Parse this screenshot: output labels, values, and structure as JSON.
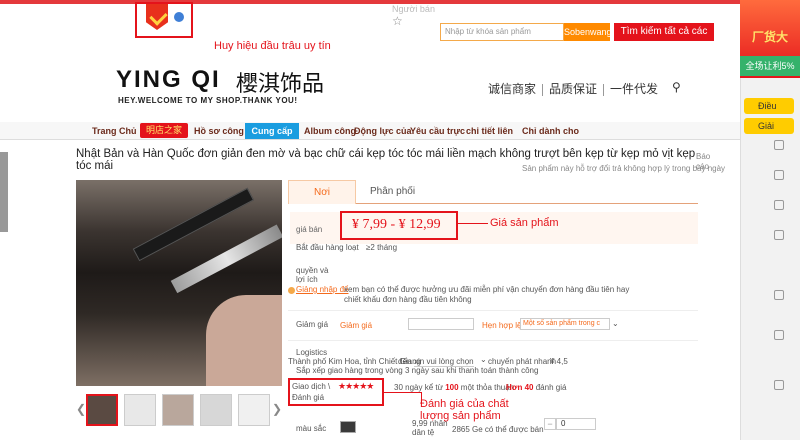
{
  "top": {
    "nav_text": "Người bán",
    "star": "☆"
  },
  "badge": {
    "annotation": "Huy hiệu đầu trâu uy tín"
  },
  "search": {
    "placeholder": "Nhập từ khóa sản phẩm",
    "button": "Sobenwang",
    "search_all": "Tìm kiếm tất cả các đài"
  },
  "promo": {
    "title": "厂货大",
    "sub": "全场让利5%"
  },
  "shop": {
    "name": "YING QI",
    "name_cn": "櫻淇饰品",
    "slogan": "HEY.WELCOME TO MY SHOP.THANK YOU!",
    "guarantees": [
      "诚信商家",
      "品质保证",
      "一件代发"
    ]
  },
  "nav": {
    "items": [
      "Trang Chủ",
      "明店之家",
      "Hồ sơ công ty",
      "Cung cấp sản",
      "Album công",
      "Động lực của",
      "Yêu cầu trực",
      "chi tiết liên",
      "Chỉ dành cho"
    ]
  },
  "side": {
    "items": [
      "Điều",
      "Giải"
    ]
  },
  "product": {
    "title": "Nhật Bản và Hàn Quốc đơn giản đen mờ và bạc chữ cái kẹp tóc tóc mái liền mạch không trượt bên kẹp từ kẹp mỏ vịt kẹp tóc mái",
    "subtitle": "Sản phẩm này hỗ trợ đổi trả không hợp lý trong bảy ngày",
    "report": "Báo cáo"
  },
  "tabs": [
    "Nơi",
    "Phân phối"
  ],
  "price": {
    "label": "giá bán",
    "value": "¥ 7,99  -  ¥ 12,99",
    "annotation": "Giá sản phẩm",
    "batch_label": "Bắt đầu hàng loạt",
    "batch_value": "≥2 tháng"
  },
  "rights": {
    "label": "quyền và lợi ích",
    "link": "Giảng nhập để",
    "text": "xem bạn có thể được hưởng ưu đãi miễn phí vận chuyển đơn hàng đầu tiên hay chiết khấu đơn hàng đầu tiên không"
  },
  "discount": {
    "label": "Giảm giá",
    "link": "Giảm giá",
    "option1": "Hẹn hợp lệ",
    "option2": "Một số sản phẩm trong c"
  },
  "logistics": {
    "label": "Logistics",
    "from": "Thành phố Kim Hoa, tỉnh Chiết Giang",
    "to_label": "đến",
    "to": "xin vui lòng chọn",
    "shipping": "chuyến phát nhanh",
    "shipping_price": "¥ 4,5",
    "note": "Sắp xếp giao hàng trong vòng 3 ngày sau khi thanh toán thành công"
  },
  "rating": {
    "label1": "Giao dịch \\",
    "label2": "Đánh giá",
    "stars": "★★★★★",
    "deals_text": "30 ngày kể từ",
    "deals_count": "100",
    "deals_suffix": "một thỏa thuận",
    "reviews_prefix": "Hơn",
    "reviews_count": "40",
    "reviews_suffix": "đánh giá",
    "annotation": "Đánh giá của chất lượng sản phẩm"
  },
  "variant": {
    "label": "màu sắc",
    "price_line": "9,99 nhân dân tệ",
    "stock": "2865 Ge có thể được bán",
    "minus": "−",
    "qty": "0"
  }
}
